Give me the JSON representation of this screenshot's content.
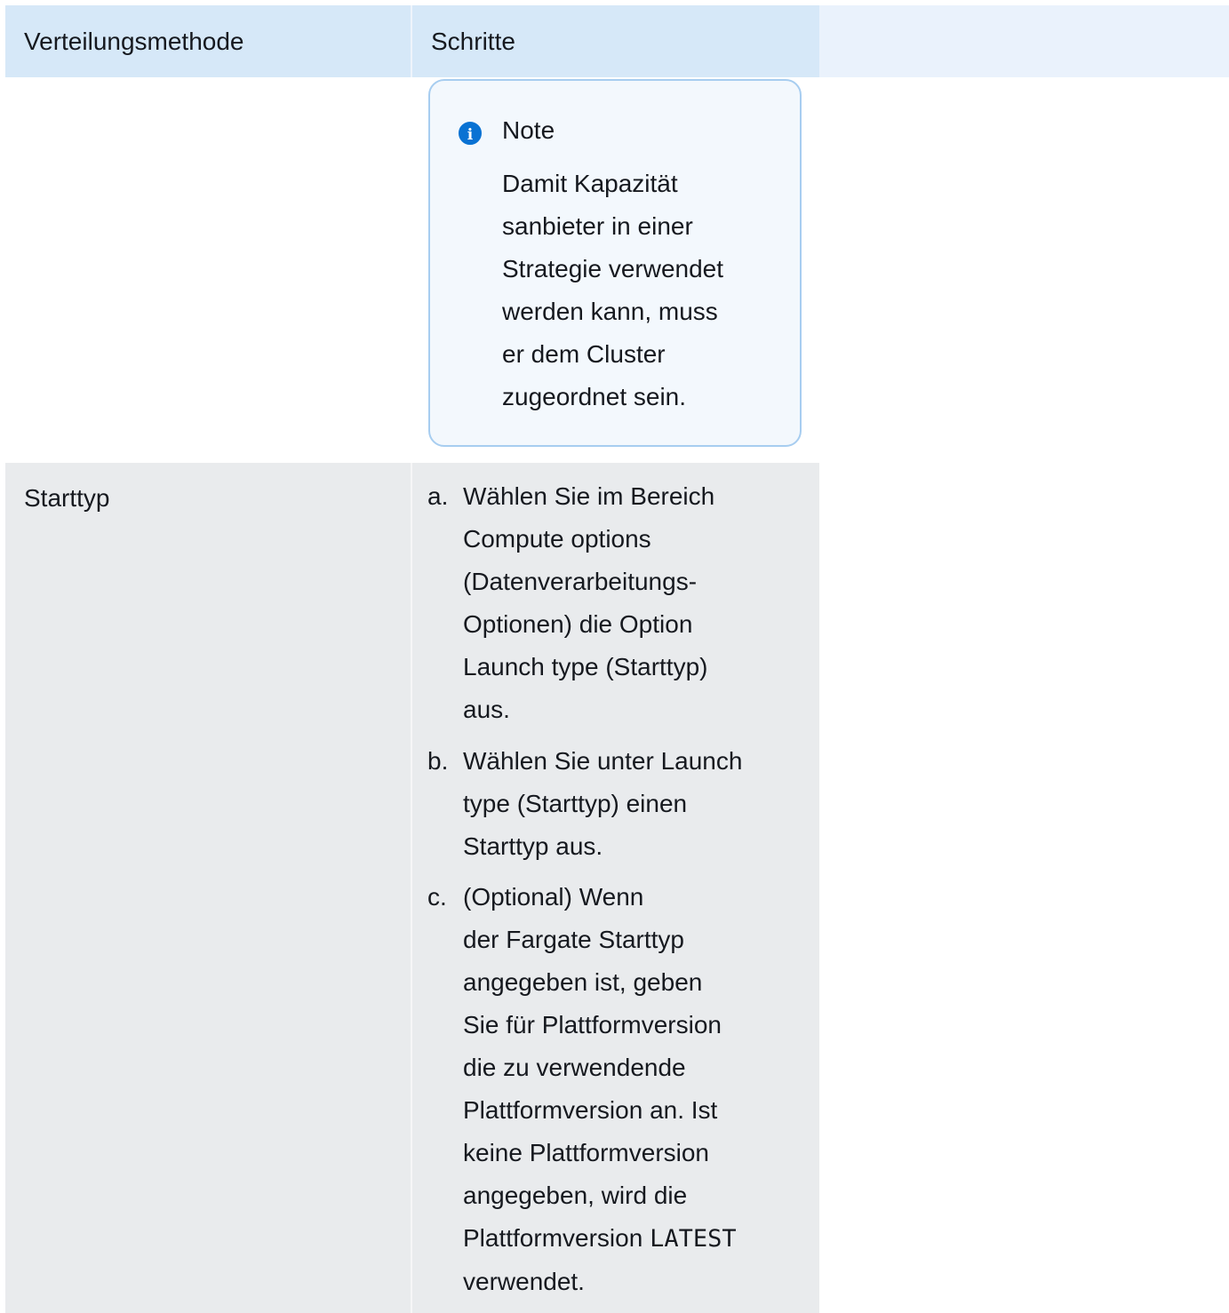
{
  "table": {
    "headers": [
      "Verteilungsmethode",
      "Schritte",
      ""
    ],
    "note": {
      "icon": "info-icon",
      "title": "Note",
      "lines": [
        "Damit Kapazität",
        "sanbieter in einer",
        "Strategie verwendet",
        "werden kann, muss",
        "er dem Cluster",
        "zugeordnet sein."
      ]
    },
    "row2": {
      "method": "Starttyp",
      "steps": [
        {
          "marker": "a.",
          "lines": [
            "Wählen Sie im Bereich",
            "Compute options",
            "(Datenverarbeitungs-",
            "Optionen) die Option",
            "Launch type (Starttyp)",
            "aus."
          ]
        },
        {
          "marker": "b.",
          "lines": [
            "Wählen Sie unter Launch",
            "type (Starttyp) einen",
            "Starttyp aus."
          ]
        },
        {
          "marker": "c.",
          "lines": [
            "(Optional) Wenn",
            "der Fargate Starttyp",
            "angegeben ist, geben",
            "Sie für Plattformversion",
            "die zu verwendende",
            "Plattformversion an. Ist",
            "keine Plattformversion",
            "angegeben, wird die",
            "Plattformversion",
            "verwendet."
          ],
          "code": "LATEST"
        }
      ]
    }
  }
}
